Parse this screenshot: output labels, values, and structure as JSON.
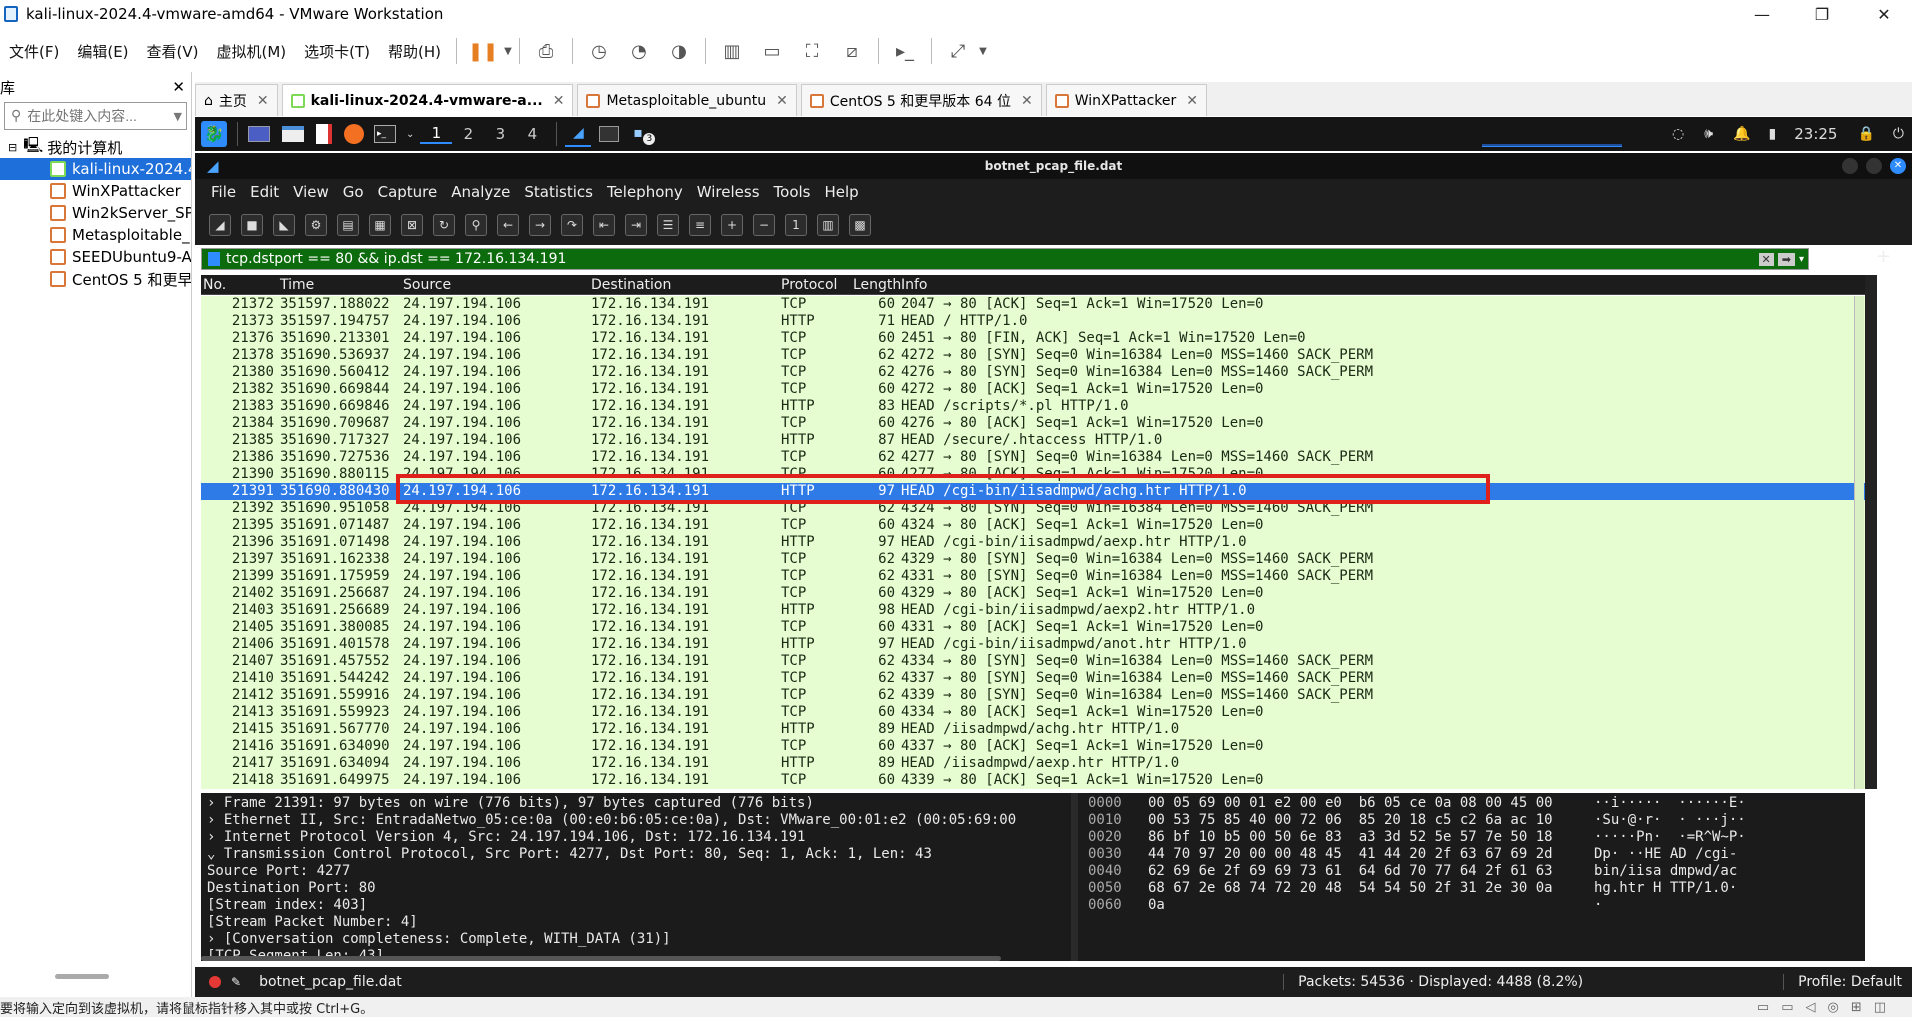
{
  "window": {
    "title": "kali-linux-2024.4-vmware-amd64 - VMware Workstation",
    "minimize": "—",
    "maximize": "❐",
    "close": "✕"
  },
  "vmmenu": [
    "文件(F)",
    "编辑(E)",
    "查看(V)",
    "虚拟机(M)",
    "选项卡(T)",
    "帮助(H)"
  ],
  "library": {
    "title": "库",
    "close": "✕",
    "search_placeholder": "在此处键入内容...",
    "root": "我的计算机",
    "items": [
      "kali-linux-2024.4",
      "WinXPattacker",
      "Win2kServer_SP",
      "Metasploitable_",
      "SEEDUbuntu9-A",
      "CentOS 5 和更早"
    ]
  },
  "tabs": [
    {
      "label": "主页"
    },
    {
      "label": "kali-linux-2024.4-vmware-a..."
    },
    {
      "label": "Metasploitable_ubuntu"
    },
    {
      "label": "CentOS 5 和更早版本 64 位"
    },
    {
      "label": "WinXPattacker"
    }
  ],
  "kali": {
    "workspaces": [
      "1",
      "2",
      "3",
      "4"
    ],
    "clock": "23:25",
    "badge": "3"
  },
  "wireshark": {
    "title": "botnet_pcap_file.dat",
    "menu": [
      "File",
      "Edit",
      "View",
      "Go",
      "Capture",
      "Analyze",
      "Statistics",
      "Telephony",
      "Wireless",
      "Tools",
      "Help"
    ],
    "filter": "tcp.dstport == 80 && ip.dst == 172.16.134.191",
    "columns": {
      "no": "No.",
      "time": "Time",
      "source": "Source",
      "destination": "Destination",
      "protocol": "Protocol",
      "length": "Length",
      "info": "Info"
    },
    "packets": [
      {
        "no": "21372",
        "time": "351597.188022",
        "src": "24.197.194.106",
        "dst": "172.16.134.191",
        "proto": "TCP",
        "len": "60",
        "info": "2047 → 80 [ACK] Seq=1 Ack=1 Win=17520 Len=0"
      },
      {
        "no": "21373",
        "time": "351597.194757",
        "src": "24.197.194.106",
        "dst": "172.16.134.191",
        "proto": "HTTP",
        "len": "71",
        "info": "HEAD / HTTP/1.0"
      },
      {
        "no": "21376",
        "time": "351690.213301",
        "src": "24.197.194.106",
        "dst": "172.16.134.191",
        "proto": "TCP",
        "len": "60",
        "info": "2451 → 80 [FIN, ACK] Seq=1 Ack=1 Win=17520 Len=0"
      },
      {
        "no": "21378",
        "time": "351690.536937",
        "src": "24.197.194.106",
        "dst": "172.16.134.191",
        "proto": "TCP",
        "len": "62",
        "info": "4272 → 80 [SYN] Seq=0 Win=16384 Len=0 MSS=1460 SACK_PERM"
      },
      {
        "no": "21380",
        "time": "351690.560412",
        "src": "24.197.194.106",
        "dst": "172.16.134.191",
        "proto": "TCP",
        "len": "62",
        "info": "4276 → 80 [SYN] Seq=0 Win=16384 Len=0 MSS=1460 SACK_PERM"
      },
      {
        "no": "21382",
        "time": "351690.669844",
        "src": "24.197.194.106",
        "dst": "172.16.134.191",
        "proto": "TCP",
        "len": "60",
        "info": "4272 → 80 [ACK] Seq=1 Ack=1 Win=17520 Len=0"
      },
      {
        "no": "21383",
        "time": "351690.669846",
        "src": "24.197.194.106",
        "dst": "172.16.134.191",
        "proto": "HTTP",
        "len": "83",
        "info": "HEAD /scripts/*.pl HTTP/1.0"
      },
      {
        "no": "21384",
        "time": "351690.709687",
        "src": "24.197.194.106",
        "dst": "172.16.134.191",
        "proto": "TCP",
        "len": "60",
        "info": "4276 → 80 [ACK] Seq=1 Ack=1 Win=17520 Len=0"
      },
      {
        "no": "21385",
        "time": "351690.717327",
        "src": "24.197.194.106",
        "dst": "172.16.134.191",
        "proto": "HTTP",
        "len": "87",
        "info": "HEAD /secure/.htaccess HTTP/1.0"
      },
      {
        "no": "21386",
        "time": "351690.727536",
        "src": "24.197.194.106",
        "dst": "172.16.134.191",
        "proto": "TCP",
        "len": "62",
        "info": "4277 → 80 [SYN] Seq=0 Win=16384 Len=0 MSS=1460 SACK_PERM"
      },
      {
        "no": "21390",
        "time": "351690.880115",
        "src": "24.197.194.106",
        "dst": "172.16.134.191",
        "proto": "TCP",
        "len": "60",
        "info": "4277 → 80 [ACK] Seq=1 Ack=1 Win=17520 Len=0"
      },
      {
        "no": "21391",
        "time": "351690.880430",
        "src": "24.197.194.106",
        "dst": "172.16.134.191",
        "proto": "HTTP",
        "len": "97",
        "info": "HEAD /cgi-bin/iisadmpwd/achg.htr HTTP/1.0",
        "selected": true
      },
      {
        "no": "21392",
        "time": "351690.951058",
        "src": "24.197.194.106",
        "dst": "172.16.134.191",
        "proto": "TCP",
        "len": "62",
        "info": "4324 → 80 [SYN] Seq=0 Win=16384 Len=0 MSS=1460 SACK_PERM"
      },
      {
        "no": "21395",
        "time": "351691.071487",
        "src": "24.197.194.106",
        "dst": "172.16.134.191",
        "proto": "TCP",
        "len": "60",
        "info": "4324 → 80 [ACK] Seq=1 Ack=1 Win=17520 Len=0"
      },
      {
        "no": "21396",
        "time": "351691.071498",
        "src": "24.197.194.106",
        "dst": "172.16.134.191",
        "proto": "HTTP",
        "len": "97",
        "info": "HEAD /cgi-bin/iisadmpwd/aexp.htr HTTP/1.0"
      },
      {
        "no": "21397",
        "time": "351691.162338",
        "src": "24.197.194.106",
        "dst": "172.16.134.191",
        "proto": "TCP",
        "len": "62",
        "info": "4329 → 80 [SYN] Seq=0 Win=16384 Len=0 MSS=1460 SACK_PERM"
      },
      {
        "no": "21399",
        "time": "351691.175959",
        "src": "24.197.194.106",
        "dst": "172.16.134.191",
        "proto": "TCP",
        "len": "62",
        "info": "4331 → 80 [SYN] Seq=0 Win=16384 Len=0 MSS=1460 SACK_PERM"
      },
      {
        "no": "21402",
        "time": "351691.256687",
        "src": "24.197.194.106",
        "dst": "172.16.134.191",
        "proto": "TCP",
        "len": "60",
        "info": "4329 → 80 [ACK] Seq=1 Ack=1 Win=17520 Len=0"
      },
      {
        "no": "21403",
        "time": "351691.256689",
        "src": "24.197.194.106",
        "dst": "172.16.134.191",
        "proto": "HTTP",
        "len": "98",
        "info": "HEAD /cgi-bin/iisadmpwd/aexp2.htr HTTP/1.0"
      },
      {
        "no": "21405",
        "time": "351691.380085",
        "src": "24.197.194.106",
        "dst": "172.16.134.191",
        "proto": "TCP",
        "len": "60",
        "info": "4331 → 80 [ACK] Seq=1 Ack=1 Win=17520 Len=0"
      },
      {
        "no": "21406",
        "time": "351691.401578",
        "src": "24.197.194.106",
        "dst": "172.16.134.191",
        "proto": "HTTP",
        "len": "97",
        "info": "HEAD /cgi-bin/iisadmpwd/anot.htr HTTP/1.0"
      },
      {
        "no": "21407",
        "time": "351691.457552",
        "src": "24.197.194.106",
        "dst": "172.16.134.191",
        "proto": "TCP",
        "len": "62",
        "info": "4334 → 80 [SYN] Seq=0 Win=16384 Len=0 MSS=1460 SACK_PERM"
      },
      {
        "no": "21410",
        "time": "351691.544242",
        "src": "24.197.194.106",
        "dst": "172.16.134.191",
        "proto": "TCP",
        "len": "62",
        "info": "4337 → 80 [SYN] Seq=0 Win=16384 Len=0 MSS=1460 SACK_PERM"
      },
      {
        "no": "21412",
        "time": "351691.559916",
        "src": "24.197.194.106",
        "dst": "172.16.134.191",
        "proto": "TCP",
        "len": "62",
        "info": "4339 → 80 [SYN] Seq=0 Win=16384 Len=0 MSS=1460 SACK_PERM"
      },
      {
        "no": "21413",
        "time": "351691.559923",
        "src": "24.197.194.106",
        "dst": "172.16.134.191",
        "proto": "TCP",
        "len": "60",
        "info": "4334 → 80 [ACK] Seq=1 Ack=1 Win=17520 Len=0"
      },
      {
        "no": "21415",
        "time": "351691.567770",
        "src": "24.197.194.106",
        "dst": "172.16.134.191",
        "proto": "HTTP",
        "len": "89",
        "info": "HEAD /iisadmpwd/achg.htr HTTP/1.0"
      },
      {
        "no": "21416",
        "time": "351691.634090",
        "src": "24.197.194.106",
        "dst": "172.16.134.191",
        "proto": "TCP",
        "len": "60",
        "info": "4337 → 80 [ACK] Seq=1 Ack=1 Win=17520 Len=0"
      },
      {
        "no": "21417",
        "time": "351691.634094",
        "src": "24.197.194.106",
        "dst": "172.16.134.191",
        "proto": "HTTP",
        "len": "89",
        "info": "HEAD /iisadmpwd/aexp.htr HTTP/1.0"
      },
      {
        "no": "21418",
        "time": "351691.649975",
        "src": "24.197.194.106",
        "dst": "172.16.134.191",
        "proto": "TCP",
        "len": "60",
        "info": "4339 → 80 [ACK] Seq=1 Ack=1 Win=17520 Len=0"
      }
    ],
    "details": [
      "› Frame 21391: 97 bytes on wire (776 bits), 97 bytes captured (776 bits)",
      "› Ethernet II, Src: EntradaNetwo_05:ce:0a (00:e0:b6:05:ce:0a), Dst: VMware_00:01:e2 (00:05:69:00",
      "› Internet Protocol Version 4, Src: 24.197.194.106, Dst: 172.16.134.191",
      "⌄ Transmission Control Protocol, Src Port: 4277, Dst Port: 80, Seq: 1, Ack: 1, Len: 43",
      "     Source Port: 4277",
      "     Destination Port: 80",
      "     [Stream index: 403]",
      "     [Stream Packet Number: 4]",
      "   › [Conversation completeness: Complete, WITH_DATA (31)]",
      "     [TCP Segment Len: 43]"
    ],
    "hex": [
      {
        "off": "0000",
        "bytes": "00 05 69 00 01 e2 00 e0  b6 05 ce 0a 08 00 45 00",
        "ascii": "··i·····  ······E·"
      },
      {
        "off": "0010",
        "bytes": "00 53 75 85 40 00 72 06  85 20 18 c5 c2 6a ac 10",
        "ascii": "·Su·@·r·  · ···j··"
      },
      {
        "off": "0020",
        "bytes": "86 bf 10 b5 00 50 6e 83  a3 3d 52 5e 57 7e 50 18",
        "ascii": "·····Pn·  ·=R^W~P·"
      },
      {
        "off": "0030",
        "bytes": "44 70 97 20 00 00 48 45  41 44 20 2f 63 67 69 2d",
        "ascii": "Dp· ··HE AD /cgi-"
      },
      {
        "off": "0040",
        "bytes": "62 69 6e 2f 69 69 73 61  64 6d 70 77 64 2f 61 63",
        "ascii": "bin/iisa dmpwd/ac"
      },
      {
        "off": "0050",
        "bytes": "68 67 2e 68 74 72 20 48  54 54 50 2f 31 2e 30 0a",
        "ascii": "hg.htr H TTP/1.0·"
      },
      {
        "off": "0060",
        "bytes": "0a",
        "ascii": "·"
      }
    ],
    "status": {
      "file": "botnet_pcap_file.dat",
      "packets": "Packets: 54536 · Displayed: 4488 (8.2%)",
      "profile": "Profile: Default"
    }
  },
  "vm_status_hint": "要将输入定向到该虚拟机，请将鼠标指针移入其中或按 Ctrl+G。"
}
